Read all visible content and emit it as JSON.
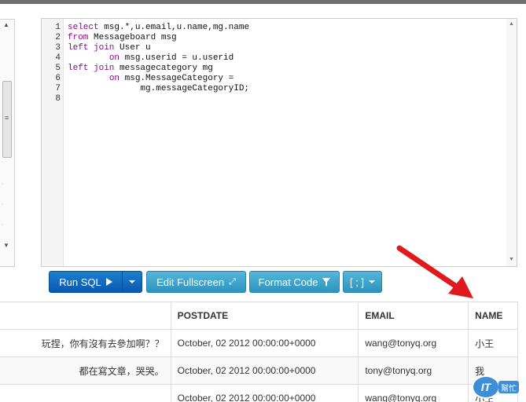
{
  "editor": {
    "line_numbers": [
      "1",
      "2",
      "3",
      "4",
      "5",
      "6",
      "7",
      "8"
    ]
  },
  "toolbar": {
    "run_label": "Run SQL",
    "fullscreen_label": "Edit Fullscreen",
    "format_label": "Format Code",
    "separator_label": "[ ; ]"
  },
  "results": {
    "headers": [
      "",
      "POSTDATE",
      "EMAIL",
      "NAME"
    ],
    "rows": [
      [
        "玩捏，你有沒有去參加啊？？",
        "October, 02 2012 00:00:00+0000",
        "wang@tonyq.org",
        "小王"
      ],
      [
        "都在寫文章，哭哭。",
        "October, 02 2012 00:00:00+0000",
        "tony@tonyq.org",
        "我"
      ],
      [
        "",
        "October, 02 2012 00:00:00+0000",
        "wang@tonyq.org",
        "小王"
      ]
    ]
  },
  "watermark": {
    "logo_text": "IT",
    "label": "幫忙"
  },
  "colors": {
    "primary": "#0a59b0",
    "info": "#2e93bd",
    "arrow": "#e0191e",
    "keyword": "#8b0a8b"
  }
}
